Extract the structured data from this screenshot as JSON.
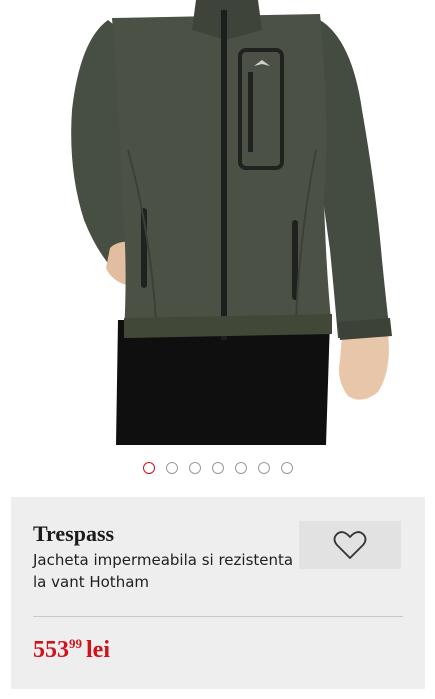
{
  "gallery": {
    "image_alt": "Trespass jacket product photo",
    "logo_icon": "trespass-logo-icon",
    "slide_count": 7,
    "active_slide": 1
  },
  "product": {
    "brand": "Trespass",
    "title": "Jacheta impermeabila si rezistenta la vant Hotham",
    "price_main": "553",
    "price_cents": "99",
    "currency": "lei",
    "favorite_icon": "heart-outline-icon"
  },
  "colors": {
    "accent": "#d0121b",
    "jacket": "#4a5144",
    "card_bg": "#eeeeee"
  }
}
